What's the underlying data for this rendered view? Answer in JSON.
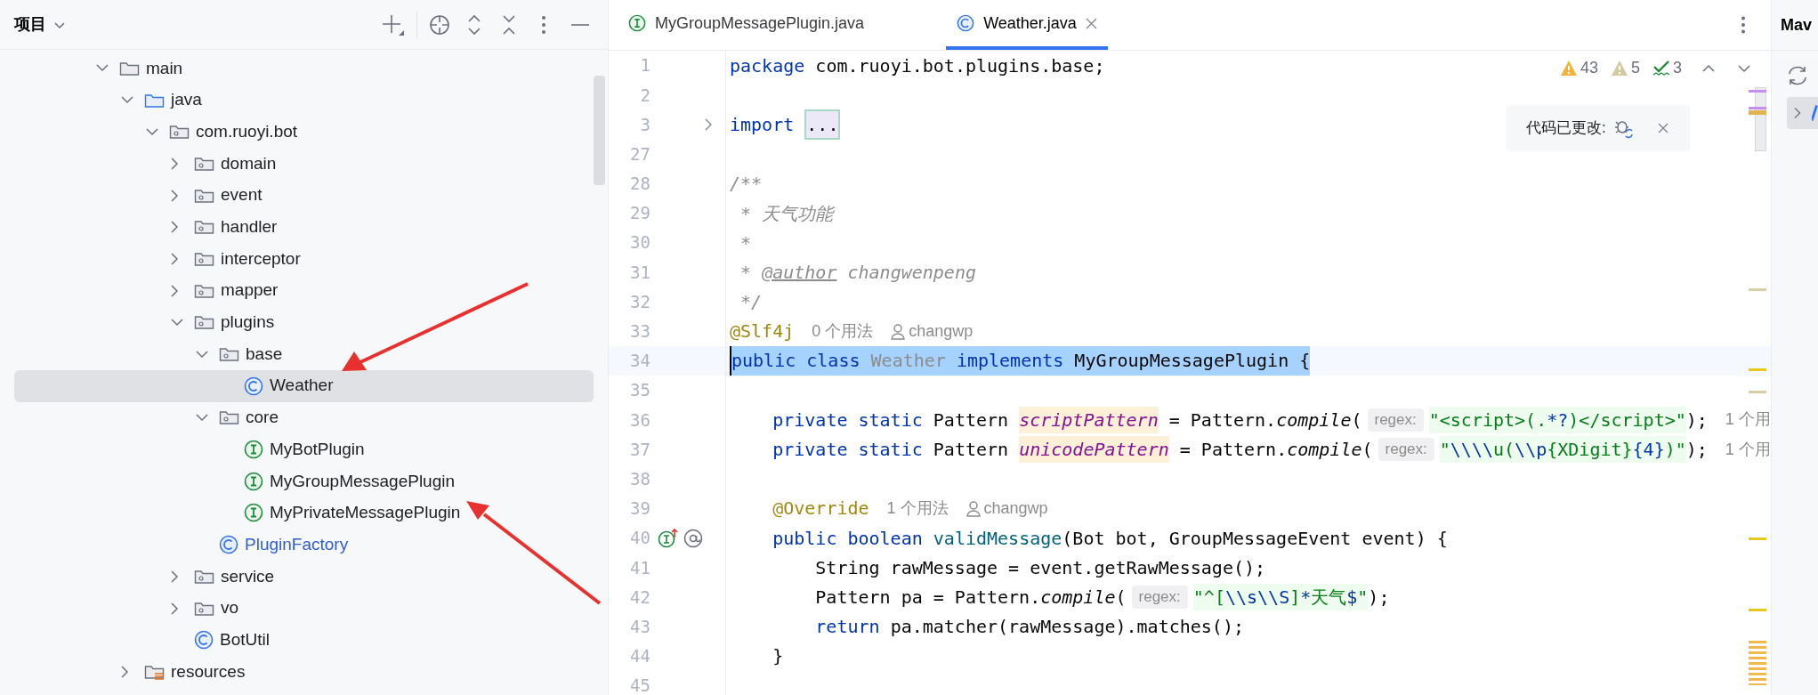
{
  "project_panel": {
    "title": "项目",
    "tree": [
      {
        "label": "main",
        "kind": "folder",
        "expanded": true,
        "selected": false,
        "modified": false,
        "children": [
          {
            "label": "java",
            "kind": "source_root",
            "expanded": true,
            "selected": false,
            "modified": false,
            "children": [
              {
                "label": "com.ruoyi.bot",
                "kind": "package",
                "expanded": true,
                "selected": false,
                "modified": false,
                "children": [
                  {
                    "label": "domain",
                    "kind": "package",
                    "expanded": false,
                    "selected": false,
                    "modified": false
                  },
                  {
                    "label": "event",
                    "kind": "package",
                    "expanded": false,
                    "selected": false,
                    "modified": false
                  },
                  {
                    "label": "handler",
                    "kind": "package",
                    "expanded": false,
                    "selected": false,
                    "modified": false
                  },
                  {
                    "label": "interceptor",
                    "kind": "package",
                    "expanded": false,
                    "selected": false,
                    "modified": false
                  },
                  {
                    "label": "mapper",
                    "kind": "package",
                    "expanded": false,
                    "selected": false,
                    "modified": false
                  },
                  {
                    "label": "plugins",
                    "kind": "package",
                    "expanded": true,
                    "selected": false,
                    "modified": false,
                    "children": [
                      {
                        "label": "base",
                        "kind": "package",
                        "expanded": true,
                        "selected": false,
                        "modified": false,
                        "children": [
                          {
                            "label": "Weather",
                            "kind": "class",
                            "selected": true,
                            "modified": false
                          }
                        ]
                      },
                      {
                        "label": "core",
                        "kind": "package",
                        "expanded": true,
                        "selected": false,
                        "modified": false,
                        "children": [
                          {
                            "label": "MyBotPlugin",
                            "kind": "interface",
                            "selected": false,
                            "modified": false
                          },
                          {
                            "label": "MyGroupMessagePlugin",
                            "kind": "interface",
                            "selected": false,
                            "modified": false
                          },
                          {
                            "label": "MyPrivateMessagePlugin",
                            "kind": "interface",
                            "selected": false,
                            "modified": false
                          }
                        ]
                      },
                      {
                        "label": "PluginFactory",
                        "kind": "class",
                        "selected": false,
                        "modified": true
                      }
                    ]
                  },
                  {
                    "label": "service",
                    "kind": "package",
                    "expanded": false,
                    "selected": false,
                    "modified": false
                  },
                  {
                    "label": "vo",
                    "kind": "package",
                    "expanded": false,
                    "selected": false,
                    "modified": false
                  },
                  {
                    "label": "BotUtil",
                    "kind": "class",
                    "selected": false,
                    "modified": false
                  }
                ]
              }
            ]
          },
          {
            "label": "resources",
            "kind": "resource_root",
            "expanded": false,
            "selected": false,
            "modified": false
          }
        ]
      }
    ]
  },
  "editor": {
    "tabs": [
      {
        "label": "MyGroupMessagePlugin.java",
        "kind": "interface",
        "selected": false
      },
      {
        "label": "Weather.java",
        "kind": "class",
        "selected": true
      }
    ],
    "inspections": [
      {
        "kind": "warning",
        "count": "43"
      },
      {
        "kind": "weak_warning",
        "count": "5"
      },
      {
        "kind": "typo",
        "count": "3"
      }
    ],
    "notification": {
      "text": "代码已更改:"
    },
    "lines": [
      {
        "number": "1",
        "selected": false,
        "tokens": [
          {
            "kind": "keyword",
            "text": "package"
          },
          {
            "kind": "plain",
            "text": " com.ruoyi.bot.plugins.base;"
          }
        ]
      },
      {
        "number": "2",
        "selected": false
      },
      {
        "number": "3",
        "selected": false,
        "kind": "fold",
        "tokens": [
          {
            "kind": "keyword",
            "text": "import"
          },
          {
            "kind": "fold",
            "text": " ..."
          }
        ]
      },
      {
        "number": "27",
        "selected": false
      },
      {
        "number": "28",
        "selected": false,
        "tokens": [
          {
            "kind": "comment",
            "text": "/**"
          }
        ]
      },
      {
        "number": "29",
        "selected": false,
        "tokens": [
          {
            "kind": "comment",
            "text": " * 天气功能"
          }
        ]
      },
      {
        "number": "30",
        "selected": false,
        "tokens": [
          {
            "kind": "comment",
            "text": " *"
          }
        ]
      },
      {
        "number": "31",
        "selected": false,
        "tokens": [
          {
            "kind": "comment",
            "text": " * "
          },
          {
            "kind": "doc_tag",
            "text": "@author"
          },
          {
            "kind": "comment",
            "text": " changwenpeng"
          }
        ]
      },
      {
        "number": "32",
        "selected": false,
        "tokens": [
          {
            "kind": "comment",
            "text": " */"
          }
        ]
      },
      {
        "number": "33",
        "selected": false,
        "tokens": [
          {
            "kind": "annotation",
            "text": "@Slf4j"
          },
          {
            "kind": "usage",
            "text": "0 个用法"
          },
          {
            "kind": "author",
            "text": "changwp"
          }
        ]
      },
      {
        "number": "34",
        "selected": true,
        "tokens": [
          {
            "kind": "keyword",
            "text": "public class"
          },
          {
            "kind": "unused",
            "text": " Weather "
          },
          {
            "kind": "keyword",
            "text": "implements"
          },
          {
            "kind": "plain",
            "text": " MyGroupMessagePlugin {"
          }
        ]
      },
      {
        "number": "35",
        "selected": false
      },
      {
        "number": "36",
        "selected": false,
        "tokens": [
          {
            "kind": "keyword",
            "text": "    private static"
          },
          {
            "kind": "plain",
            "text": " Pattern "
          },
          {
            "kind": "field",
            "text": "scriptPattern"
          },
          {
            "kind": "plain",
            "text": " = Pattern."
          },
          {
            "kind": "static_call",
            "text": "compile"
          },
          {
            "kind": "plain",
            "text": "("
          },
          {
            "kind": "inlay",
            "text": "regex:"
          },
          {
            "kind": "string",
            "text": "\"<script>(."
          },
          {
            "kind": "escape",
            "text": "*?"
          },
          {
            "kind": "string",
            "text": ")</script>\""
          },
          {
            "kind": "plain",
            "text": ");"
          },
          {
            "kind": "usage",
            "text": "1 个用"
          }
        ]
      },
      {
        "number": "37",
        "selected": false,
        "tokens": [
          {
            "kind": "keyword",
            "text": "    private static"
          },
          {
            "kind": "plain",
            "text": " Pattern "
          },
          {
            "kind": "field",
            "text": "unicodePattern"
          },
          {
            "kind": "plain",
            "text": " = Pattern."
          },
          {
            "kind": "static_call",
            "text": "compile"
          },
          {
            "kind": "plain",
            "text": "("
          },
          {
            "kind": "inlay",
            "text": "regex:"
          },
          {
            "kind": "string",
            "text": "\""
          },
          {
            "kind": "escape",
            "text": "\\\\\\\\"
          },
          {
            "kind": "string",
            "text": "u("
          },
          {
            "kind": "escape",
            "text": "\\\\p"
          },
          {
            "kind": "string",
            "text": "{XDigit}"
          },
          {
            "kind": "escape",
            "text": "{4}"
          },
          {
            "kind": "string",
            "text": ")\""
          },
          {
            "kind": "plain",
            "text": ");"
          },
          {
            "kind": "usage",
            "text": "1 个用"
          }
        ]
      },
      {
        "number": "38",
        "selected": false
      },
      {
        "number": "39",
        "selected": false,
        "tokens": [
          {
            "kind": "annotation",
            "text": "    @Override"
          },
          {
            "kind": "usage",
            "text": "1 个用法"
          },
          {
            "kind": "author",
            "text": "changwp"
          }
        ]
      },
      {
        "number": "40",
        "selected": false,
        "kind": "implements",
        "tokens": [
          {
            "kind": "keyword",
            "text": "    public boolean"
          },
          {
            "kind": "method",
            "text": " validMessage"
          },
          {
            "kind": "plain",
            "text": "(Bot bot, GroupMessageEvent event) {"
          }
        ]
      },
      {
        "number": "41",
        "selected": false,
        "tokens": [
          {
            "kind": "plain",
            "text": "        String rawMessage = event.getRawMessage();"
          }
        ]
      },
      {
        "number": "42",
        "selected": false,
        "tokens": [
          {
            "kind": "plain",
            "text": "        Pattern pa = Pattern."
          },
          {
            "kind": "static_call",
            "text": "compile"
          },
          {
            "kind": "plain",
            "text": "("
          },
          {
            "kind": "inlay",
            "text": "regex:"
          },
          {
            "kind": "string",
            "text": "\"^["
          },
          {
            "kind": "escape",
            "text": "\\\\s\\\\S"
          },
          {
            "kind": "string",
            "text": "]"
          },
          {
            "kind": "escape",
            "text": "*"
          },
          {
            "kind": "string",
            "text": "天气"
          },
          {
            "kind": "escape",
            "text": "$"
          },
          {
            "kind": "string",
            "text": "\""
          },
          {
            "kind": "plain",
            "text": ");"
          }
        ]
      },
      {
        "number": "43",
        "selected": false,
        "tokens": [
          {
            "kind": "keyword",
            "text": "        return"
          },
          {
            "kind": "plain",
            "text": " pa.matcher(rawMessage).matches();"
          }
        ]
      },
      {
        "number": "44",
        "selected": false,
        "tokens": [
          {
            "kind": "plain",
            "text": "    }"
          }
        ]
      },
      {
        "number": "45",
        "selected": false
      }
    ]
  },
  "maven_panel": {
    "title": "Mav"
  }
}
